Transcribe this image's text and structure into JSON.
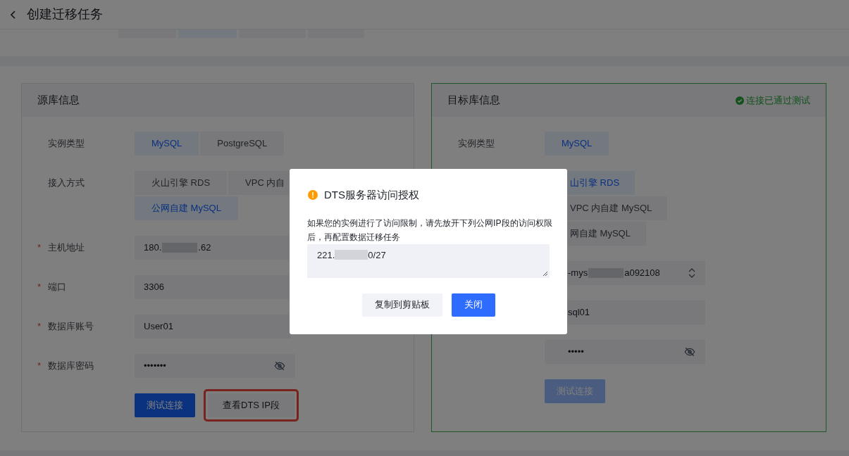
{
  "header": {
    "title": "创建迁移任务"
  },
  "source": {
    "title": "源库信息",
    "rows": [
      {
        "kind": "options",
        "label": "实例类型",
        "options": [
          {
            "label": "MySQL",
            "selected": true
          },
          {
            "label": "PostgreSQL",
            "selected": false
          }
        ]
      },
      {
        "kind": "options",
        "label": "接入方式",
        "options": [
          {
            "label": "火山引擎 RDS",
            "selected": false
          },
          {
            "label": "VPC 内自",
            "selected": false
          },
          {
            "label": "公网自建 MySQL",
            "selected": true
          }
        ]
      },
      {
        "kind": "input",
        "required_mark": "*",
        "label": "主机地址",
        "value": "180.",
        "value_end": ".62",
        "redacted": true
      },
      {
        "kind": "input",
        "required_mark": "*",
        "label": "端口",
        "value": "3306"
      },
      {
        "kind": "input",
        "required_mark": "*",
        "label": "数据库账号",
        "value": "User01"
      },
      {
        "kind": "password",
        "required_mark": "*",
        "label": "数据库密码",
        "value": "•••••••"
      },
      {
        "kind": "actions",
        "buttons": [
          {
            "label": "测试连接",
            "kind": "primary",
            "highlighted": false
          },
          {
            "label": "查看DTS IP段",
            "kind": "secondary",
            "highlighted": true
          }
        ]
      }
    ]
  },
  "target": {
    "title": "目标库信息",
    "status": "连接已通过测试",
    "rows": [
      {
        "kind": "options",
        "label": "实例类型",
        "options": [
          {
            "label": "MySQL",
            "selected": true
          }
        ]
      },
      {
        "kind": "options",
        "options": [
          {
            "label": "山引擎 RDS",
            "selected": true
          },
          {
            "label": "VPC 内自建 MySQL",
            "selected": false
          },
          {
            "label": "网自建 MySQL",
            "selected": false
          }
        ]
      },
      {
        "kind": "select",
        "value": "-mys",
        "value_end": "a092108",
        "redacted": true
      },
      {
        "kind": "input",
        "value": "sql01"
      },
      {
        "kind": "password",
        "value": "•••••"
      },
      {
        "kind": "actions",
        "buttons": [
          {
            "label": "测试连接",
            "kind": "primary",
            "disabled": true
          }
        ]
      }
    ]
  },
  "dialog": {
    "title": "DTS服务器访问授权",
    "message": "如果您的实例进行了访问限制，请先放开下列公网IP段的访问权限后，再配置数据迁移任务",
    "ip_value": "221.",
    "ip_value_end": "0/27",
    "buttons": [
      {
        "label": "复制到剪贴板",
        "kind": "secondary"
      },
      {
        "label": "关闭",
        "kind": "primary"
      }
    ]
  }
}
